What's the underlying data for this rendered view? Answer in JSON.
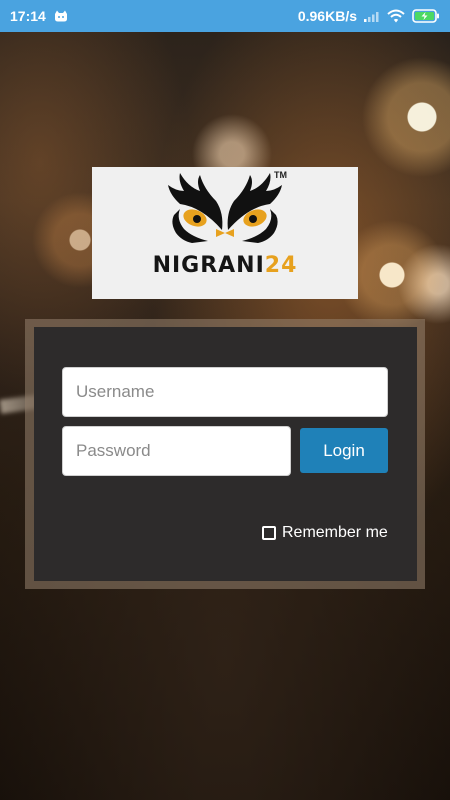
{
  "status_bar": {
    "time": "17:14",
    "network_speed": "0.96KB/s",
    "icons": [
      "notification-cat-icon",
      "signal-icon",
      "wifi-icon",
      "battery-charging-icon"
    ],
    "background_color": "#4aa3e0"
  },
  "logo": {
    "brand_name_part1": "NIGRANI",
    "brand_name_part2": "24",
    "trademark": "TM",
    "accent_color": "#e7a11e"
  },
  "login_form": {
    "username_placeholder": "Username",
    "username_value": "",
    "password_placeholder": "Password",
    "password_value": "",
    "login_label": "Login",
    "remember_label": "Remember me",
    "remember_checked": false,
    "button_color": "#1f81b8"
  }
}
